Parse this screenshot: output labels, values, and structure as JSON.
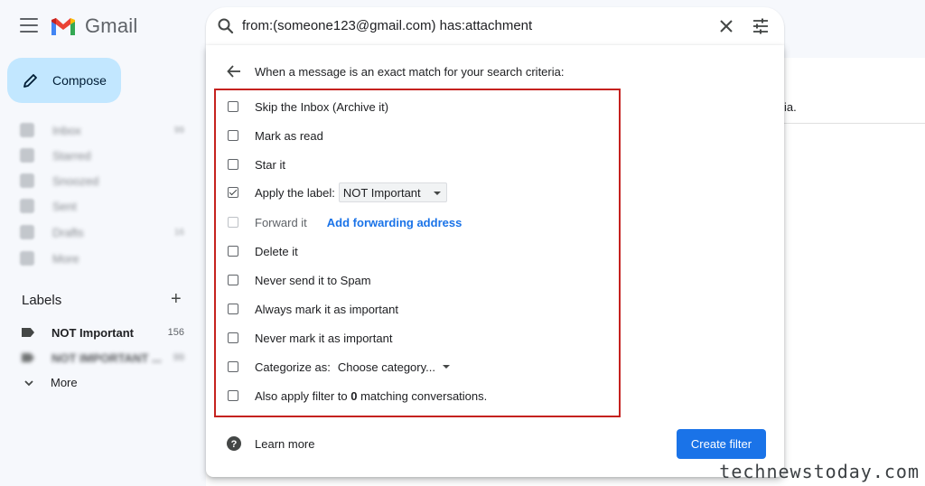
{
  "header": {
    "app_name": "Gmail",
    "search_query": "from:(someone123@gmail.com) has:attachment"
  },
  "sidebar": {
    "compose_label": "Compose",
    "nav_items": [
      {
        "label": "Inbox",
        "count": "99"
      },
      {
        "label": "Starred",
        "count": ""
      },
      {
        "label": "Snoozed",
        "count": ""
      },
      {
        "label": "Sent",
        "count": ""
      },
      {
        "label": "Drafts",
        "count": "16"
      },
      {
        "label": "More",
        "count": ""
      }
    ],
    "labels_heading": "Labels",
    "labels": [
      {
        "name": "NOT Important",
        "count": "156"
      },
      {
        "name": "NOT IMPORTANT ...",
        "count": "99"
      }
    ],
    "more_label": "More"
  },
  "main": {
    "trailing_text": "ia."
  },
  "dialog": {
    "title": "When a message is an exact match for your search criteria:",
    "options": {
      "skip_inbox": "Skip the Inbox (Archive it)",
      "mark_read": "Mark as read",
      "star": "Star it",
      "apply_label": "Apply the label:",
      "apply_label_value": "NOT Important",
      "forward": "Forward it",
      "add_forwarding": "Add forwarding address",
      "delete": "Delete it",
      "never_spam": "Never send it to Spam",
      "always_important": "Always mark it as important",
      "never_important": "Never mark it as important",
      "categorize": "Categorize as:",
      "categorize_value": "Choose category...",
      "also_apply_prefix": "Also apply filter to ",
      "also_apply_count": "0",
      "also_apply_suffix": " matching conversations."
    },
    "checked": {
      "apply_label": true
    },
    "learn_more": "Learn more",
    "create_filter": "Create filter"
  },
  "watermark": "technewstoday.com",
  "colors": {
    "accent": "#1a73e8",
    "compose_bg": "#c2e7ff",
    "highlight": "#c5221f"
  }
}
